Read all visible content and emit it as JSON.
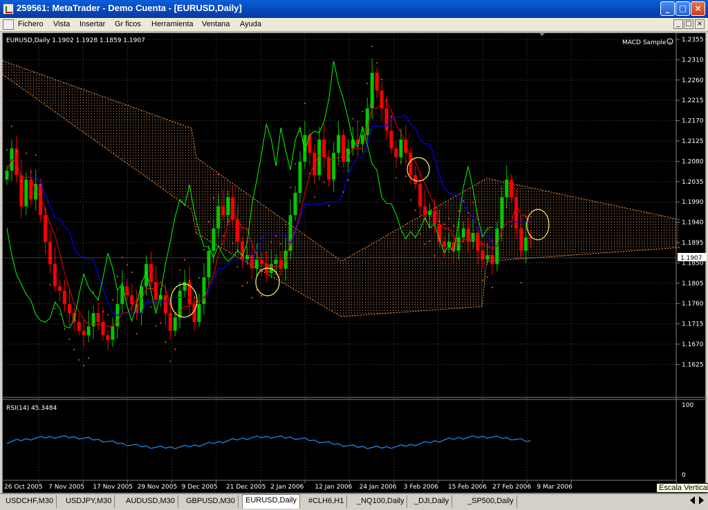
{
  "window": {
    "title": "259561: MetaTrader - Demo Cuenta - [EURUSD,Daily]",
    "minimize": "_",
    "maximize": "□",
    "close": "×"
  },
  "menu": [
    "Fichero",
    "Vista",
    "Insertar",
    "Gr ficos",
    "Herramienta",
    "Ventana",
    "Ayuda"
  ],
  "mdi": {
    "minimize": "_",
    "restore": "□",
    "close": "×"
  },
  "chart": {
    "header": "EURUSD,Daily  1.1902 1.1928 1.1859 1.1907",
    "expert_label": "MACD Sample",
    "current_price": "1.1907",
    "price_ticks": [
      "1.2355",
      "1.2310",
      "1.2260",
      "1.2215",
      "1.2170",
      "1.2125",
      "1.2080",
      "1.2035",
      "1.1990",
      "1.1940",
      "1.1895",
      "1.1850",
      "1.1805",
      "1.1760",
      "1.1715",
      "1.1670",
      "1.1625"
    ],
    "time_labels": [
      "26 Oct 2005",
      "7 Nov 2005",
      "17 Nov 2005",
      "29 Nov 2005",
      "9 Dec 2005",
      "21 Dec 2005",
      "2 Jan 2006",
      "12 Jan 2006",
      "24 Jan 2006",
      "3 Feb 2006",
      "15 Feb 2006",
      "27 Feb 2006",
      "9 Mar 2006"
    ],
    "colors": {
      "up": "#00c800",
      "down": "#ff0000",
      "kijun": "#0000ff",
      "tenkan": "#ff0000",
      "chikou": "#00ff00",
      "cloud": "#ffa050",
      "rsi": "#1e90ff"
    }
  },
  "rsi": {
    "header": "RSI(14) 45.3484",
    "top": "100",
    "bottom": "0"
  },
  "tabs": [
    "USDCHF,M30",
    "USDJPY,M30",
    "AUDUSD,M30",
    "GBPUSD,M30",
    "EURUSD,Daily",
    "#CLH6,H1",
    "_NQ100,Daily",
    "_DJI,Daily",
    "_SP500,Daily"
  ],
  "active_tab": "EURUSD,Daily",
  "tooltip": "Escala Vertical"
}
